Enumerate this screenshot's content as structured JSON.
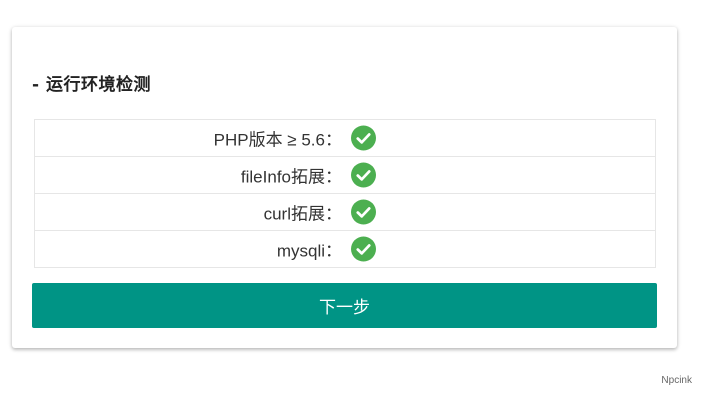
{
  "section": {
    "title": "- 运行环境检测"
  },
  "checks": [
    {
      "label": "PHP版本 ≥ 5.6：",
      "status": "pass",
      "icon": "check-circle-icon"
    },
    {
      "label": "fileInfo拓展：",
      "status": "pass",
      "icon": "check-circle-icon"
    },
    {
      "label": "curl拓展：",
      "status": "pass",
      "icon": "check-circle-icon"
    },
    {
      "label": "mysqli：",
      "status": "pass",
      "icon": "check-circle-icon"
    }
  ],
  "next_button": {
    "label": "下一步"
  },
  "footer": {
    "brand": "Npcink"
  },
  "colors": {
    "button_bg": "#009485",
    "check_green": "#4CAF50"
  }
}
